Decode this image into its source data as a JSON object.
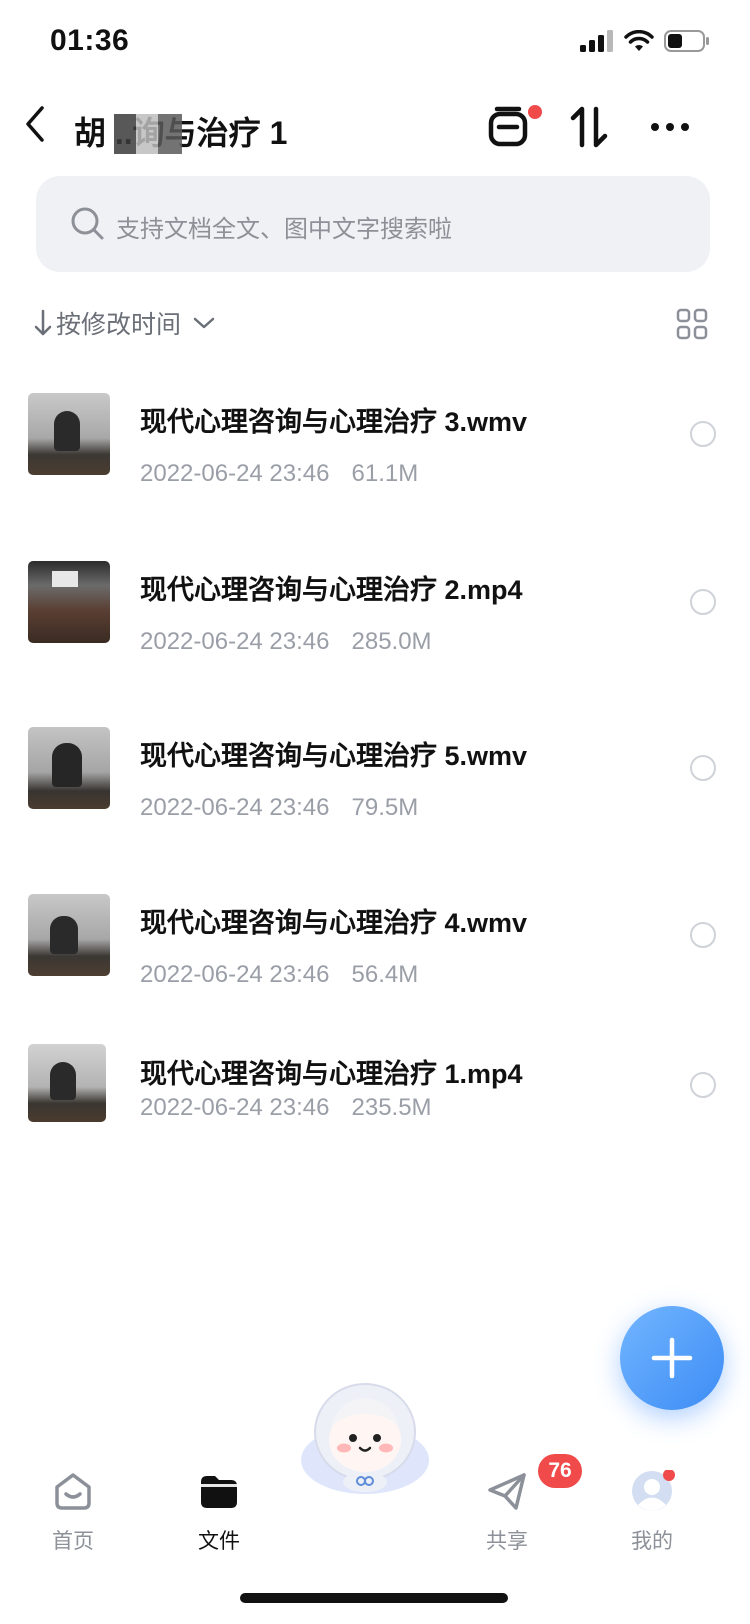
{
  "status_bar": {
    "time": "01:36"
  },
  "header": {
    "title": "胡 ..询与治疗 1"
  },
  "search": {
    "placeholder": "支持文档全文、图中文字搜索啦"
  },
  "sort": {
    "label": "按修改时间"
  },
  "files": [
    {
      "name": "现代心理咨询与心理治疗  3.wmv",
      "date": "2022-06-24 23:46",
      "size": "61.1M"
    },
    {
      "name": "现代心理咨询与心理治疗  2.mp4",
      "date": "2022-06-24 23:46",
      "size": "285.0M"
    },
    {
      "name": "现代心理咨询与心理治疗  5.wmv",
      "date": "2022-06-24 23:46",
      "size": "79.5M"
    },
    {
      "name": "现代心理咨询与心理治疗  4.wmv",
      "date": "2022-06-24 23:46",
      "size": "56.4M"
    },
    {
      "name": "现代心理咨询与心理治疗  1.mp4",
      "date": "2022-06-24 23:46",
      "size": "235.5M"
    }
  ],
  "bottom_nav": {
    "home": "首页",
    "files": "文件",
    "share": "共享",
    "share_badge": "76",
    "mine": "我的"
  },
  "colors": {
    "accent": "#3d8cf5",
    "badge": "#f04a4a",
    "muted_text": "#9a9ea7"
  },
  "icons": [
    "back-arrow-icon",
    "clip-icon",
    "sort-toggle-icon",
    "more-icon",
    "search-icon",
    "chevron-down-icon",
    "grid-view-icon",
    "plus-icon",
    "home-icon",
    "folder-icon",
    "mascot-icon",
    "paper-plane-icon",
    "avatar-icon"
  ]
}
